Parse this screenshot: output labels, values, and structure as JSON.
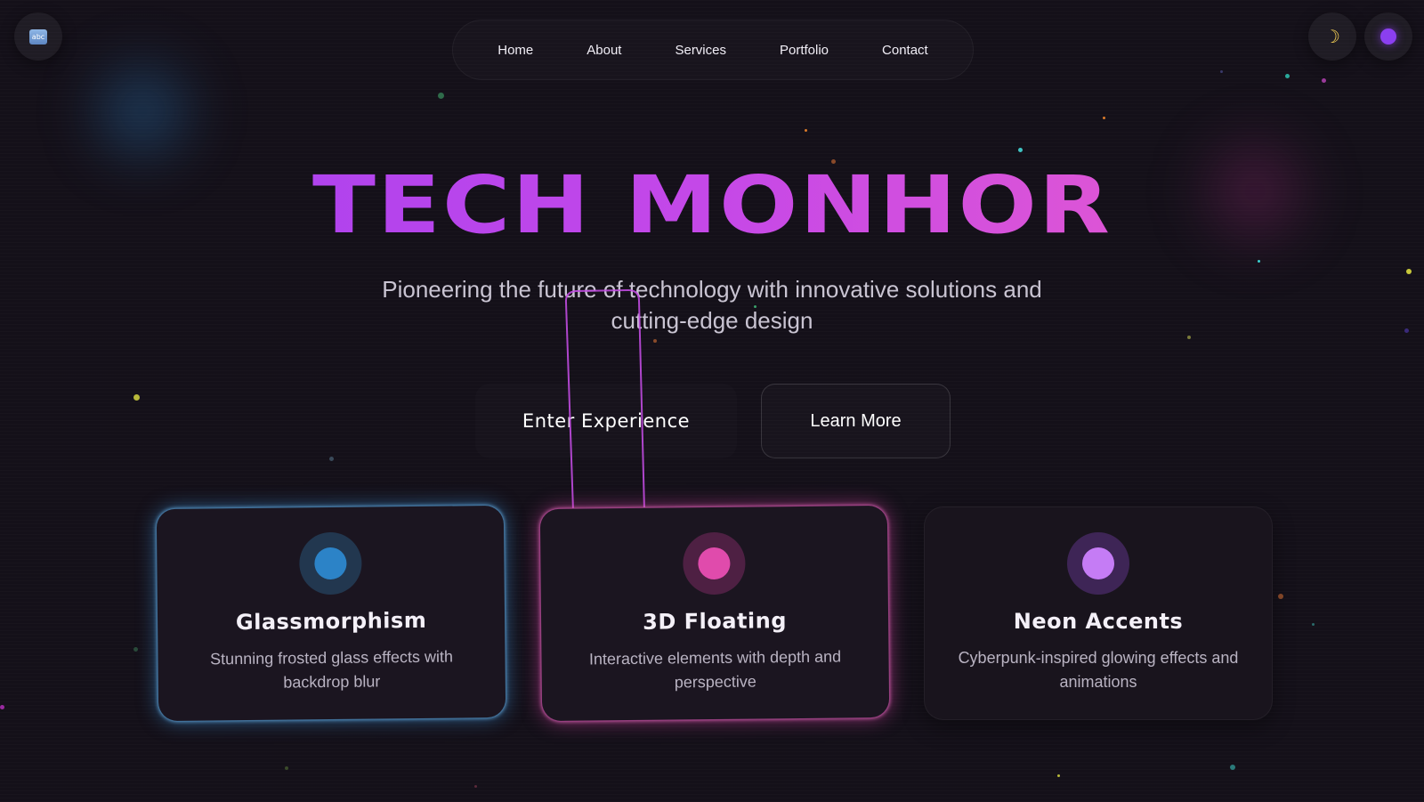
{
  "header": {
    "left_badge": "abc",
    "theme_icon": "moon-icon",
    "status_color": "#8b3ff0"
  },
  "nav": {
    "items": [
      {
        "label": "Home"
      },
      {
        "label": "About"
      },
      {
        "label": "Services"
      },
      {
        "label": "Portfolio"
      },
      {
        "label": "Contact"
      }
    ]
  },
  "hero": {
    "title": "TECH MONHOR",
    "subtitle_line1": "Pioneering the future of technology with innovative solutions and",
    "subtitle_line2": "cutting-edge design"
  },
  "buttons": {
    "primary_label": "Enter Experience",
    "secondary_label": "Learn More"
  },
  "features": [
    {
      "title": "Glassmorphism",
      "desc_line1": "Stunning frosted glass effects with",
      "desc_line2": "backdrop blur",
      "accent": "#2c83c7"
    },
    {
      "title": "3D Floating",
      "desc_line1": "Interactive elements with depth and",
      "desc_line2": "perspective",
      "accent": "#e04bac"
    },
    {
      "title": "Neon Accents",
      "desc_line1": "Cyberpunk-inspired glowing effects and",
      "desc_line2": "animations",
      "accent": "#c57cf5"
    }
  ],
  "colors": {
    "background": "#141019",
    "title_gradient_start": "#a13ff2",
    "title_gradient_end": "#ef5fc8"
  }
}
